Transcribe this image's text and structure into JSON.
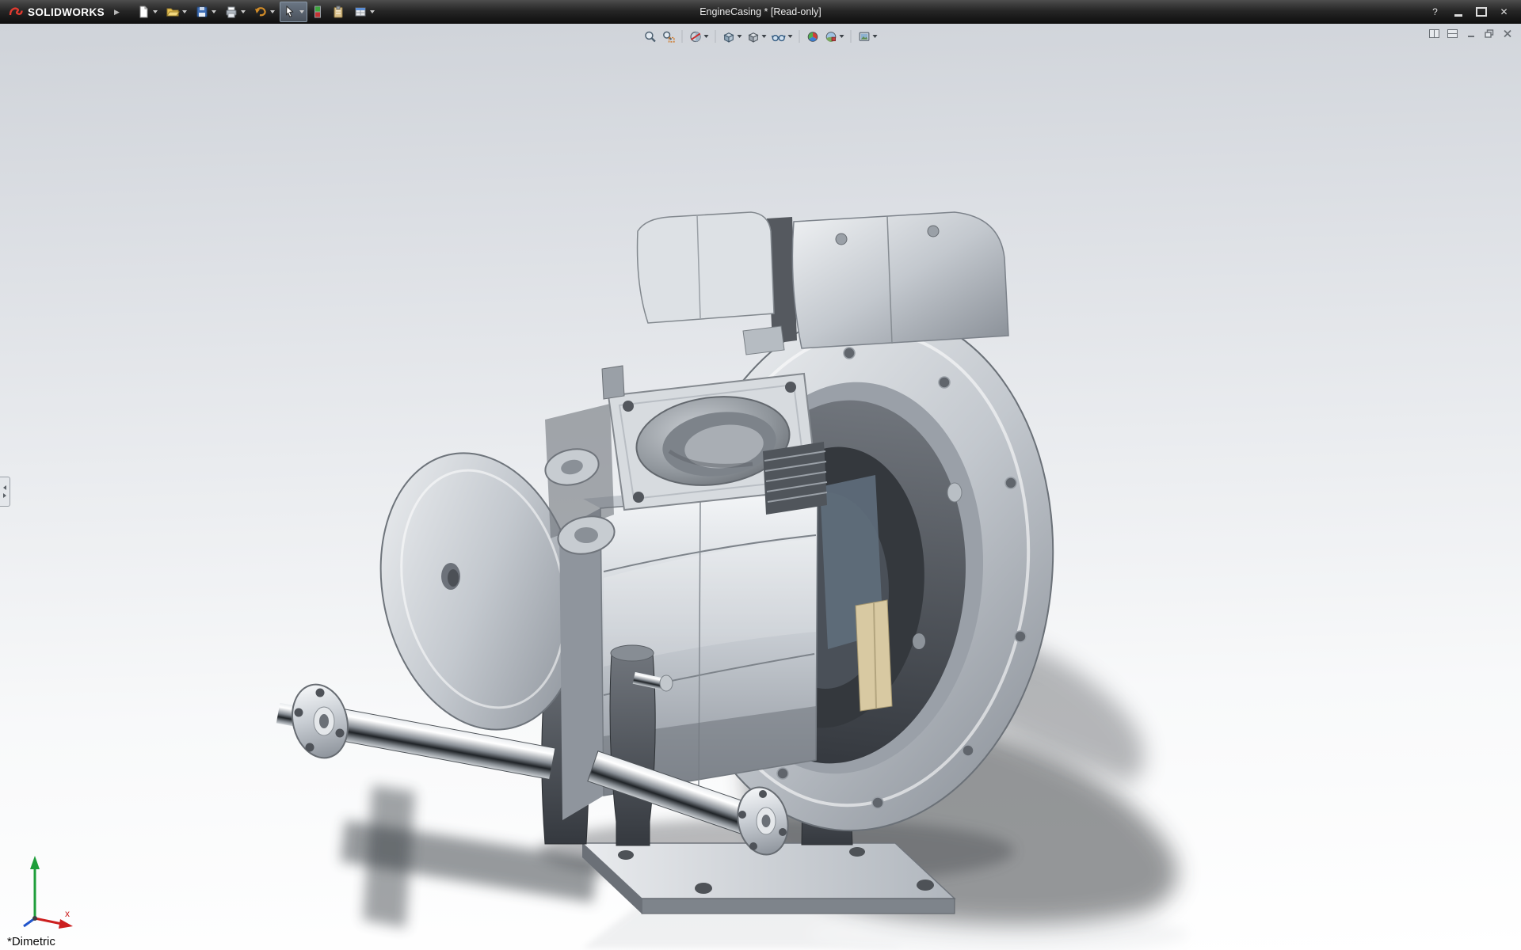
{
  "window": {
    "brand": "SOLIDWORKS",
    "title": "EngineCasing * [Read-only]",
    "controls": {
      "help": "?",
      "close_glyph": "✕"
    }
  },
  "title_toolbar": {
    "items": [
      {
        "name": "new"
      },
      {
        "name": "open"
      },
      {
        "name": "save"
      },
      {
        "name": "print"
      },
      {
        "name": "undo"
      },
      {
        "name": "select",
        "active": true
      },
      {
        "name": "selection-filter"
      },
      {
        "name": "clipboard"
      },
      {
        "name": "options"
      }
    ]
  },
  "heads_up_toolbar": {
    "items": [
      {
        "name": "zoom-to-fit"
      },
      {
        "name": "zoom-to-area"
      },
      {
        "name": "section-view"
      },
      {
        "name": "view-orientation"
      },
      {
        "name": "display-style"
      },
      {
        "name": "hide-show-items"
      },
      {
        "name": "edit-appearance"
      },
      {
        "name": "apply-scene"
      },
      {
        "name": "view-settings"
      }
    ]
  },
  "document_controls": {
    "items": [
      "pane-toggle-1",
      "pane-toggle-2",
      "minimize",
      "restore",
      "close"
    ]
  },
  "viewport": {
    "orientation_label": "*Dimetric",
    "triad": {
      "x_label": "x"
    }
  },
  "colors": {
    "titlebar": "#1d1d1d",
    "accent_red": "#d92b2b",
    "viewport_gradient_top": "#cfd3d9",
    "viewport_gradient_bottom": "#ffffff",
    "metal_light": "#eef0f3",
    "metal_dark": "#45494f"
  }
}
